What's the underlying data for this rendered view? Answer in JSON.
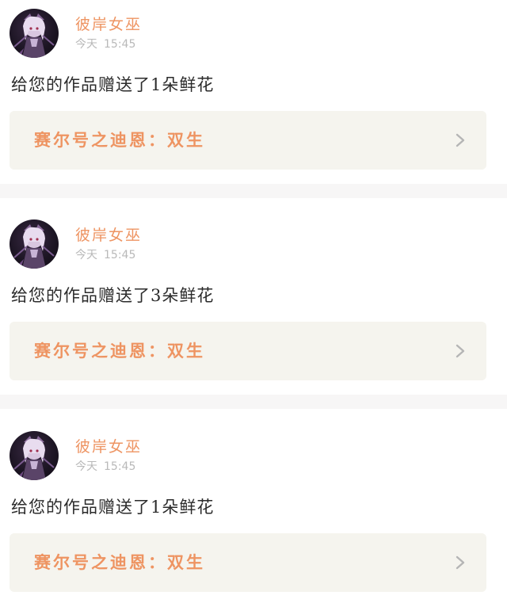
{
  "cards": [
    {
      "username": "彼岸女巫",
      "date": "今天",
      "time": "15:45",
      "message": "给您的作品赠送了1朵鲜花",
      "work_title": "赛尔号之迪恩：双生",
      "avatar_icon": "anime-girl-avatar",
      "chevron_icon": "chevron-right-icon"
    },
    {
      "username": "彼岸女巫",
      "date": "今天",
      "time": "15:45",
      "message": "给您的作品赠送了3朵鲜花",
      "work_title": "赛尔号之迪恩：双生",
      "avatar_icon": "anime-girl-avatar",
      "chevron_icon": "chevron-right-icon"
    },
    {
      "username": "彼岸女巫",
      "date": "今天",
      "time": "15:45",
      "message": "给您的作品赠送了1朵鲜花",
      "work_title": "赛尔号之迪恩：双生",
      "avatar_icon": "anime-girl-avatar",
      "chevron_icon": "chevron-right-icon"
    }
  ],
  "colors": {
    "accent": "#ee9462",
    "muted": "#b9b9b9",
    "text": "#2b2b2b",
    "link_bg": "#f5f4ee",
    "separator": "#f7f6f6"
  }
}
